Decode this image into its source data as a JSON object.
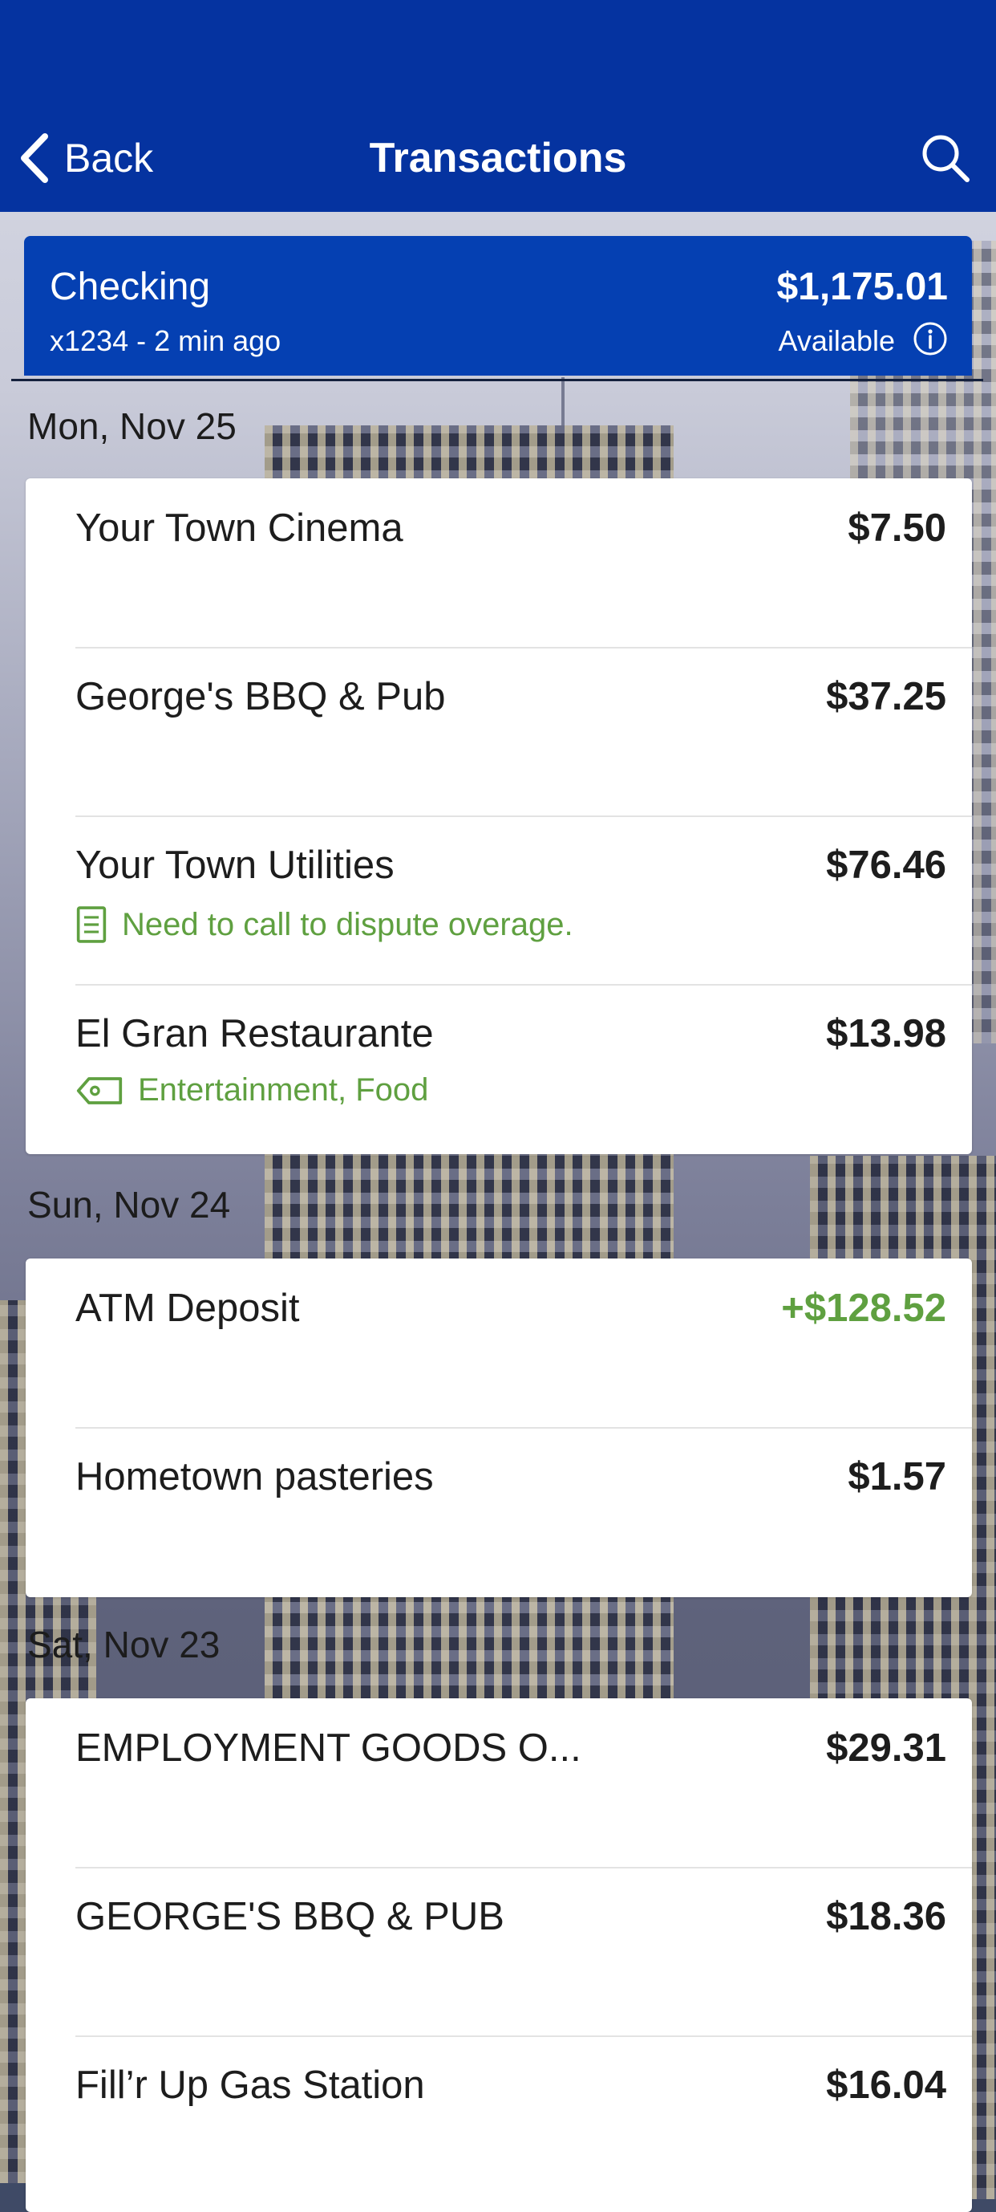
{
  "header": {
    "back_label": "Back",
    "title": "Transactions"
  },
  "account": {
    "name": "Checking",
    "meta": "x1234 - 2 min ago",
    "balance": "$1,175.01",
    "available_label": "Available"
  },
  "groups": [
    {
      "date": "Mon, Nov 25",
      "transactions": [
        {
          "name": "Your Town Cinema",
          "amount": "$7.50"
        },
        {
          "name": "George's BBQ & Pub",
          "amount": "$37.25"
        },
        {
          "name": "Your Town Utilities",
          "amount": "$76.46",
          "note": "Need to call to dispute overage."
        },
        {
          "name": "El Gran Restaurante",
          "amount": "$13.98",
          "tags": "Entertainment, Food"
        }
      ]
    },
    {
      "date": "Sun, Nov 24",
      "transactions": [
        {
          "name": "ATM Deposit",
          "amount": "+$128.52"
        },
        {
          "name": "Hometown pasteries",
          "amount": "$1.57"
        }
      ]
    },
    {
      "date": "Sat, Nov 23",
      "transactions": [
        {
          "name": "EMPLOYMENT GOODS O...",
          "amount": "$29.31"
        },
        {
          "name": "GEORGE'S BBQ & PUB",
          "amount": "$18.36"
        },
        {
          "name": "Fill’r Up Gas Station",
          "amount": "$16.04"
        }
      ]
    }
  ],
  "colors": {
    "header_bg": "#0533a0",
    "account_bg": "#0540b2",
    "accent_green": "#5fa040"
  },
  "icons": {
    "back": "chevron-left-icon",
    "search": "search-icon",
    "info": "info-icon",
    "note": "note-icon",
    "tag": "tag-icon"
  }
}
